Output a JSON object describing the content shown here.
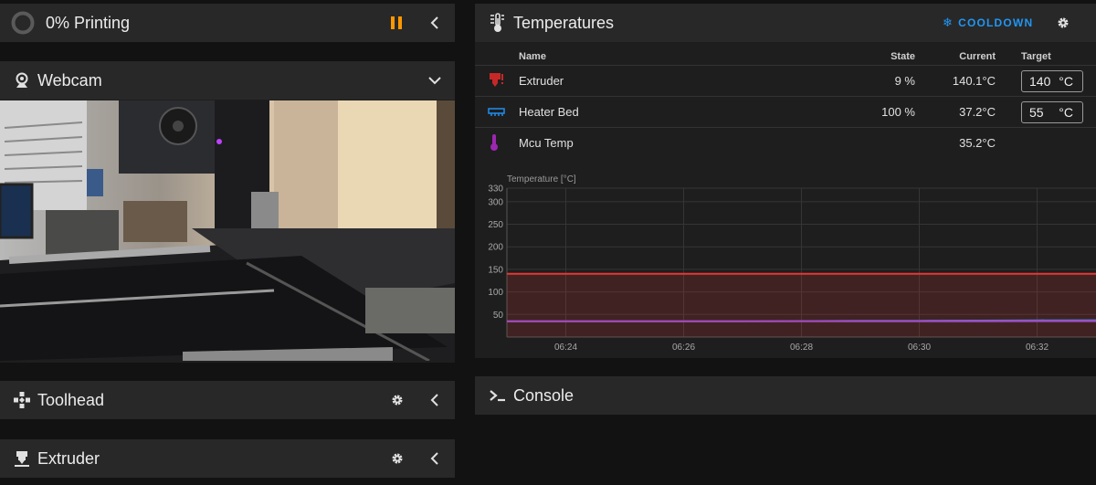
{
  "status": {
    "title": "0% Printing",
    "progress": 0
  },
  "webcam": {
    "title": "Webcam"
  },
  "toolhead": {
    "title": "Toolhead"
  },
  "extruder_panel": {
    "title": "Extruder"
  },
  "console": {
    "title": "Console"
  },
  "temperatures": {
    "title": "Temperatures",
    "cooldown_label": "COOLDOWN",
    "columns": {
      "name": "Name",
      "state": "State",
      "current": "Current",
      "target": "Target"
    },
    "rows": [
      {
        "name": "Extruder",
        "state": "9 %",
        "current": "140.1°C",
        "target": "140",
        "unit": "°C",
        "color": "#d32f2f"
      },
      {
        "name": "Heater Bed",
        "state": "100 %",
        "current": "37.2°C",
        "target": "55",
        "unit": "°C",
        "color": "#1e88e5"
      },
      {
        "name": "Mcu Temp",
        "state": "",
        "current": "35.2°C",
        "color": "#9c27b0"
      }
    ]
  },
  "colors": {
    "accent_blue": "#2196f3",
    "pause_orange": "#ff9800"
  },
  "chart_data": {
    "type": "line",
    "ylabel": "Temperature [°C]",
    "ylim": [
      0,
      330
    ],
    "yticks": [
      330,
      300,
      250,
      200,
      150,
      100,
      50
    ],
    "xticks": [
      "06:24",
      "06:26",
      "06:28",
      "06:30",
      "06:32"
    ],
    "xlim": [
      "06:23",
      "06:33"
    ],
    "grid": true,
    "series": [
      {
        "name": "Extruder",
        "color": "#e53935",
        "values": [
          140,
          140,
          140,
          140,
          140,
          140,
          140,
          140,
          140,
          140,
          140
        ]
      },
      {
        "name": "Heater Bed",
        "color": "#3f7fe0",
        "values": [
          35,
          35,
          35,
          35,
          35,
          35.5,
          36,
          36,
          36.5,
          37,
          37.2
        ]
      },
      {
        "name": "Mcu Temp",
        "color": "#ab47bc",
        "values": [
          35,
          35,
          35,
          35,
          35,
          35,
          35,
          35,
          35,
          35.2,
          35.2
        ]
      }
    ]
  }
}
